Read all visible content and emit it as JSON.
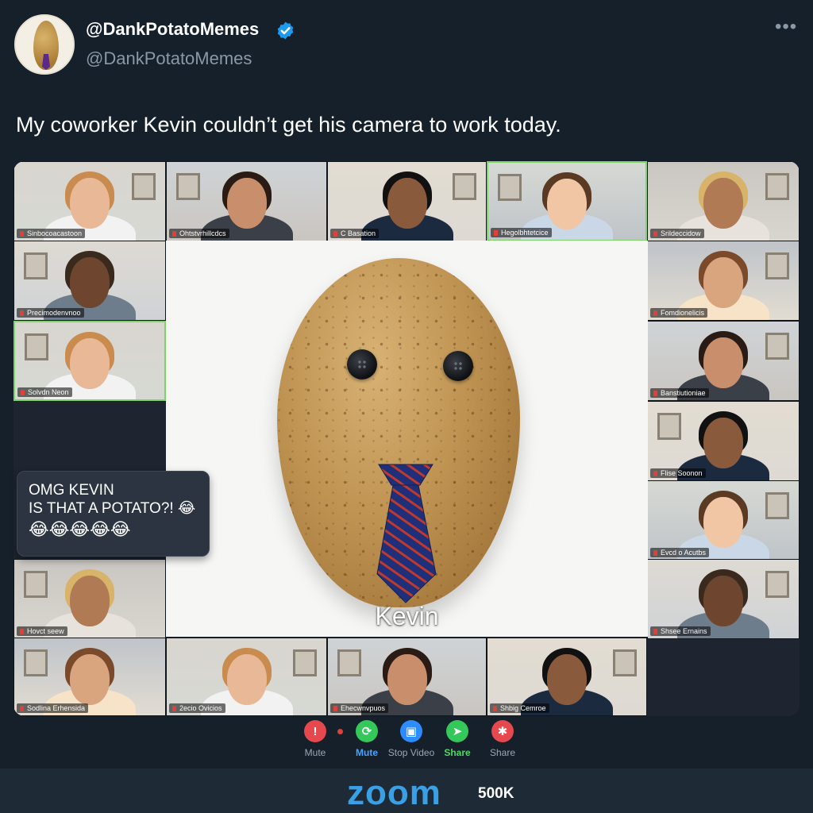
{
  "post": {
    "display_name": "@DankPotatoMemes",
    "handle": "@DankPotatoMemes",
    "verified": true,
    "text": "My coworker Kevin couldn’t get his camera to work today.",
    "more_icon": "more-icon"
  },
  "meeting": {
    "featured_name": "Kevin",
    "participants": [
      "Sinbocoacastoon",
      "Ohtstvrhillcdcs",
      "C Basation",
      "Hegolbhtetcice",
      "Srildeccidow",
      "Precimodenvnoo",
      "Fomdionelicis",
      "Solvdn Neon",
      "Banstiutioniae",
      "Flise Soonon",
      "Evcd o Acutbs",
      "Hovct seew",
      "Shsee Ernains",
      "Sodlina Erhensida",
      "2ecio Ovicios",
      "Ehecwnvpuos",
      "Shbig Cemroe"
    ],
    "chat": {
      "line1": "OMG KEVIN",
      "line2": "IS THAT A POTATO?! 😂",
      "line3": "😂😂😂😂😂"
    },
    "controls": [
      {
        "label": "Mute",
        "icon": "alert-icon",
        "color": "#e5484d",
        "style": "gray"
      },
      {
        "label": "Mute",
        "icon": "refresh-icon",
        "color": "#34c759",
        "style": "blue"
      },
      {
        "label": "Stop Video",
        "icon": "video-icon",
        "color": "#2d8cff",
        "style": "gray"
      },
      {
        "label": "Share",
        "icon": "share-arrow-icon",
        "color": "#34c759",
        "style": "green"
      },
      {
        "label": "Share",
        "icon": "share-gear-icon",
        "color": "#e5484d",
        "style": "gray"
      }
    ]
  },
  "footer": {
    "brand": "zoom",
    "count": "500K"
  },
  "colors": {
    "background": "#15202b",
    "accent": "#1d9bf0",
    "zoom_blue": "#3aa0e6",
    "active_border": "#7fd36b"
  }
}
